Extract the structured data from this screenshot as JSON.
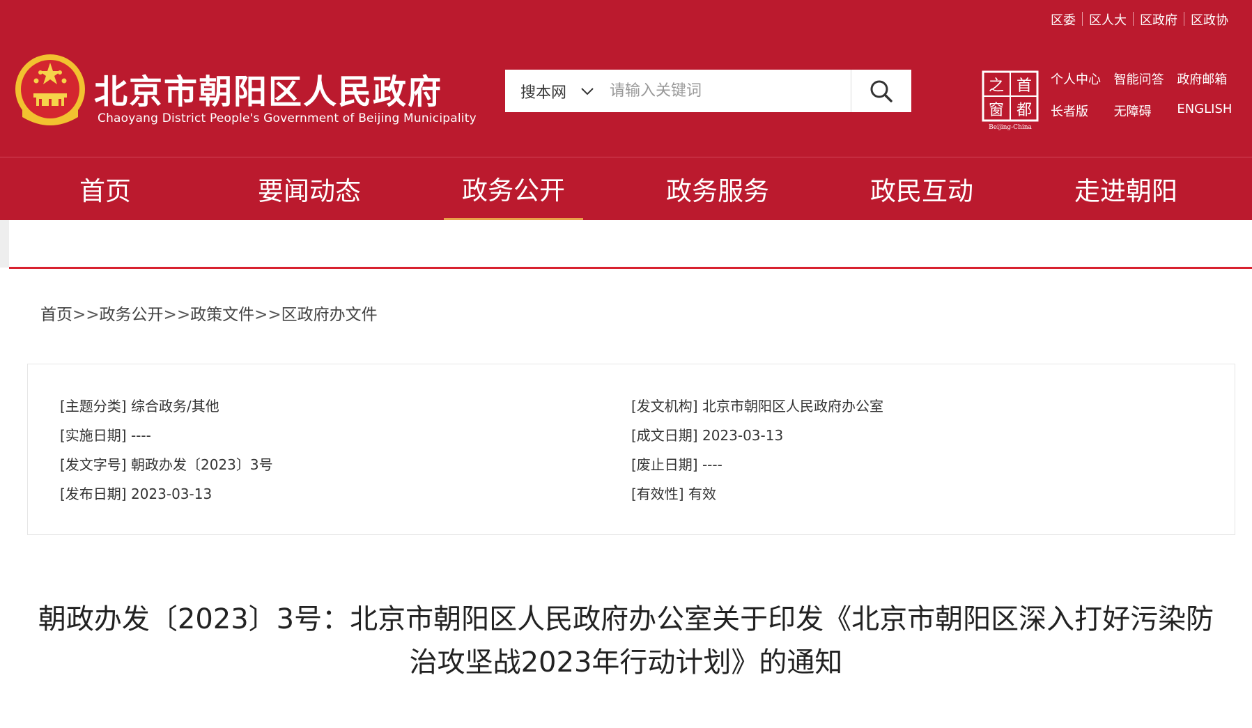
{
  "colors": {
    "brand_red": "#bb1a2e",
    "accent_line": "#d8222f",
    "active_underline": "#e9a14a"
  },
  "top_links": [
    "区委",
    "区人大",
    "区政府",
    "区政协"
  ],
  "site": {
    "title": "北京市朝阳区人民政府",
    "subtitle": "Chaoyang District People's Government of Beijing Municipality",
    "emblem_icon": "national-emblem-icon",
    "capital_logo_text": [
      "之",
      "首",
      "窗",
      "都"
    ],
    "capital_logo_caption": "Beijing-China"
  },
  "search": {
    "scope": "搜本网",
    "placeholder": "请输入关键词",
    "icon": "search-icon"
  },
  "quick_links": {
    "row1": [
      "个人中心",
      "智能问答",
      "政府邮箱"
    ],
    "row2": [
      "长者版",
      "无障碍",
      "ENGLISH"
    ]
  },
  "nav": {
    "tabs": [
      "首页",
      "要闻动态",
      "政务公开",
      "政务服务",
      "政民互动",
      "走进朝阳"
    ],
    "active": "政务公开"
  },
  "breadcrumb": {
    "items": [
      "首页",
      "政务公开",
      "政策文件",
      "区政府办文件"
    ],
    "separator": ">>"
  },
  "meta": {
    "left": [
      {
        "label": "[主题分类]",
        "value": "综合政务/其他"
      },
      {
        "label": "[实施日期]",
        "value": "----"
      },
      {
        "label": "[发文字号]",
        "value": "朝政办发〔2023〕3号"
      },
      {
        "label": "[发布日期]",
        "value": "2023-03-13"
      }
    ],
    "right": [
      {
        "label": "[发文机构]",
        "value": "北京市朝阳区人民政府办公室"
      },
      {
        "label": "[成文日期]",
        "value": "2023-03-13"
      },
      {
        "label": "[废止日期]",
        "value": "----"
      },
      {
        "label": "[有效性]",
        "value": "有效"
      }
    ]
  },
  "document": {
    "title_line1": "朝政办发〔2023〕3号：北京市朝阳区人民政府办公室关于印发《北京市朝阳区深入打好污染防",
    "title_line2": "治攻坚战2023年行动计划》的通知"
  }
}
